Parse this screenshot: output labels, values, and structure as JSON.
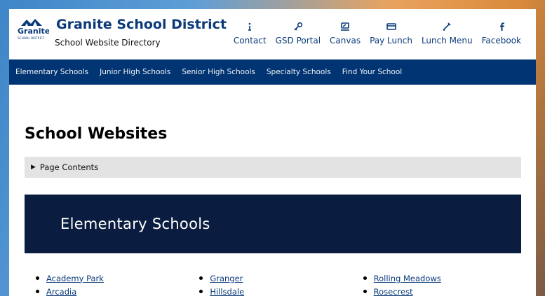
{
  "header": {
    "logo_text": "Granite",
    "logo_sub": "SCHOOL DISTRICT",
    "title": "Granite School District",
    "subtitle": "School Website Directory"
  },
  "quick_links": [
    {
      "label": "Contact",
      "icon": "info-icon"
    },
    {
      "label": "GSD Portal",
      "icon": "key-icon"
    },
    {
      "label": "Canvas",
      "icon": "canvas-icon"
    },
    {
      "label": "Pay Lunch",
      "icon": "credit-card-icon"
    },
    {
      "label": "Lunch Menu",
      "icon": "pencil-icon"
    },
    {
      "label": "Facebook",
      "icon": "facebook-icon"
    }
  ],
  "nav": {
    "items": [
      "Elementary Schools",
      "Junior High Schools",
      "Senior High Schools",
      "Specialty Schools",
      "Find Your School"
    ]
  },
  "main": {
    "heading": "School Websites",
    "details_label": "Page Contents",
    "section_heading": "Elementary Schools",
    "columns": [
      [
        "Academy Park",
        "Arcadia"
      ],
      [
        "Granger",
        "Hillsdale"
      ],
      [
        "Rolling Meadows",
        "Rosecrest"
      ]
    ]
  },
  "colors": {
    "brand_blue": "#0a3a7a",
    "nav_bg": "#003472",
    "banner_bg": "#0a1c3f",
    "details_bg": "#e3e3e3"
  }
}
